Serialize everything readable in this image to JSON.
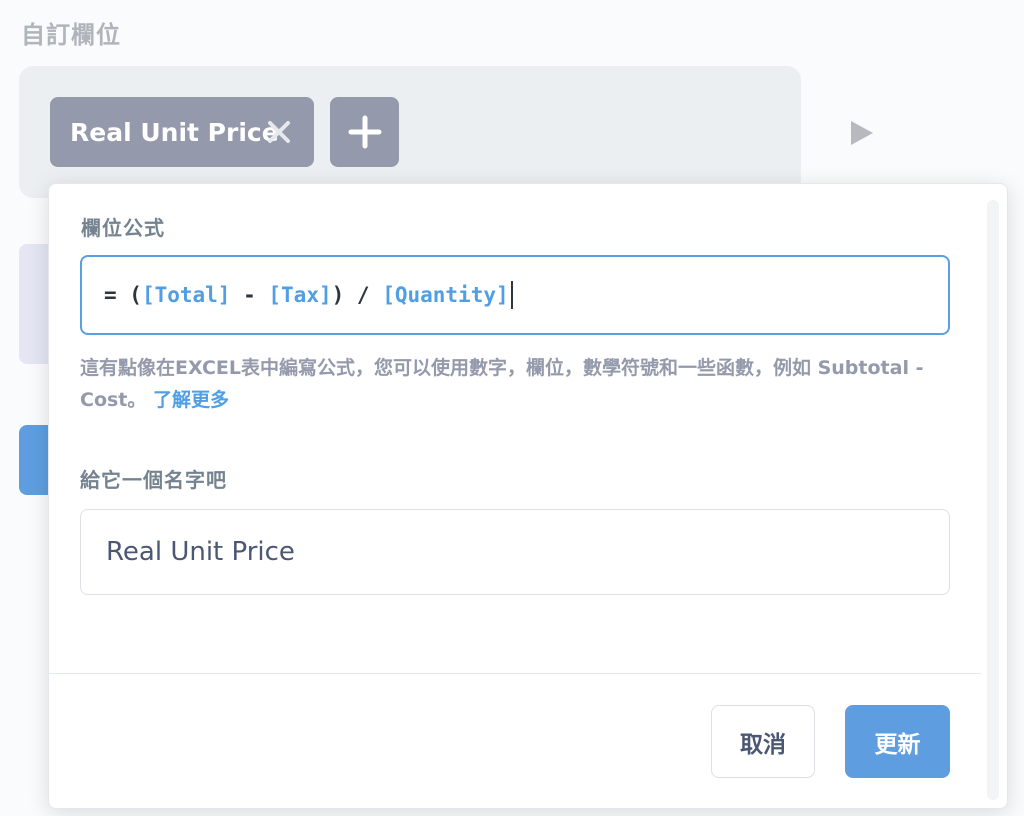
{
  "section": {
    "title": "自訂欄位"
  },
  "custom_column": {
    "chip_label": "Real Unit Price",
    "chip_close_icon": "close-icon",
    "add_icon": "plus-icon",
    "run_icon": "play-icon"
  },
  "popover": {
    "formula_label": "欄位公式",
    "formula": {
      "tokens": [
        {
          "text": "= (",
          "type": "op"
        },
        {
          "text": "[Total]",
          "type": "field"
        },
        {
          "text": " - ",
          "type": "op"
        },
        {
          "text": "[Tax]",
          "type": "field"
        },
        {
          "text": ") / ",
          "type": "op"
        },
        {
          "text": "[Quantity]",
          "type": "field"
        }
      ]
    },
    "help_text": "這有點像在EXCEL表中編寫公式，您可以使用數字，欄位，數學符號和一些函數，例如 Subtotal - Cost。",
    "help_link": "了解更多",
    "name_label": "給它一個名字吧",
    "name_value": "Real Unit Price",
    "cancel_label": "取消",
    "update_label": "更新"
  },
  "colors": {
    "accent": "#509ee3",
    "chip": "#949aab",
    "primary_button": "#5e9ee0"
  }
}
